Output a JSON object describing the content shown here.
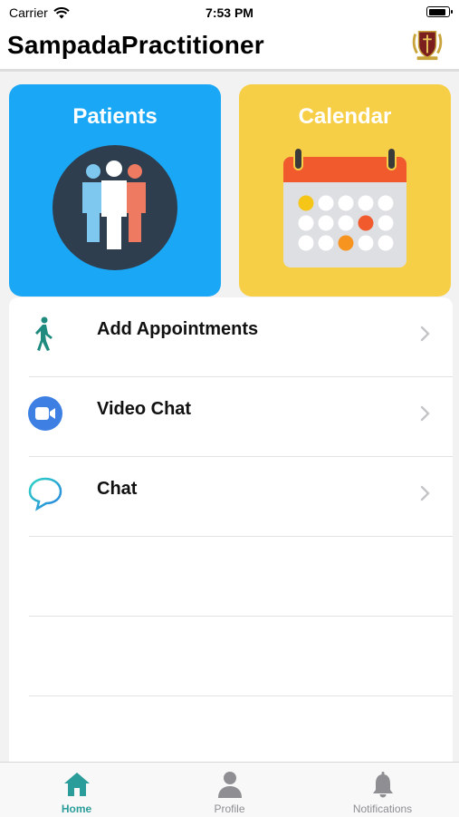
{
  "status_bar": {
    "carrier": "Carrier",
    "time": "7:53 PM"
  },
  "header": {
    "title": "SampadaPractitioner",
    "logo_icon": "crest-logo-icon"
  },
  "cards": [
    {
      "label": "Patients",
      "icon": "patients-group-icon",
      "color": "#1aa7f5"
    },
    {
      "label": "Calendar",
      "icon": "calendar-icon",
      "color": "#f7cf47"
    }
  ],
  "menu": {
    "items": [
      {
        "label": "Add Appointments",
        "icon": "walking-person-icon"
      },
      {
        "label": "Video Chat",
        "icon": "video-camera-icon"
      },
      {
        "label": "Chat",
        "icon": "chat-bubble-icon"
      }
    ]
  },
  "tabs": [
    {
      "label": "Home",
      "icon": "home-icon",
      "active": true
    },
    {
      "label": "Profile",
      "icon": "profile-icon",
      "active": false
    },
    {
      "label": "Notifications",
      "icon": "bell-icon",
      "active": false
    }
  ],
  "colors": {
    "accent": "#2a9d9a",
    "inactive": "#8e8e93",
    "video": "#3d7fe3"
  }
}
